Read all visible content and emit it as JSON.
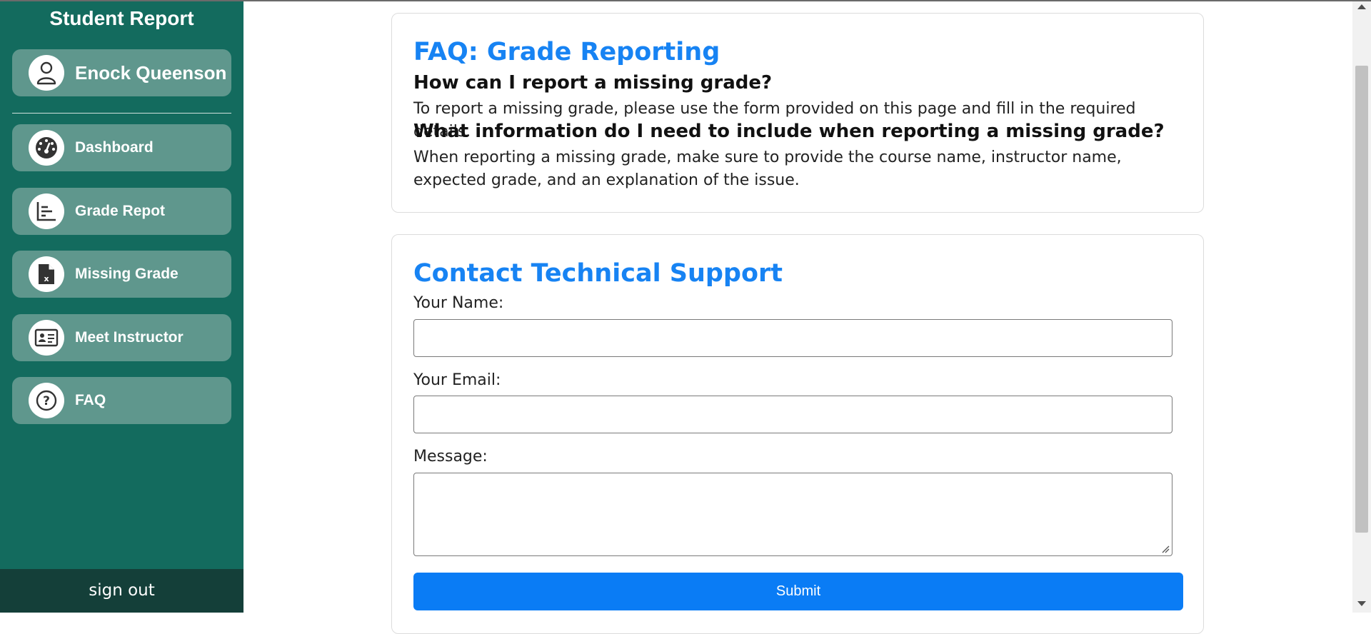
{
  "sidebar": {
    "title": "Student Report",
    "user_name": "Enock Queenson",
    "items": [
      {
        "label": "Dashboard",
        "icon": "dashboard-gauge-icon"
      },
      {
        "label": "Grade Repot",
        "icon": "bar-chart-icon"
      },
      {
        "label": "Missing Grade",
        "icon": "file-x-icon"
      },
      {
        "label": "Meet Instructor",
        "icon": "id-card-icon"
      },
      {
        "label": "FAQ",
        "icon": "question-circle-icon"
      }
    ],
    "sign_out": "sign out"
  },
  "faq": {
    "title": "FAQ: Grade Reporting",
    "q1": "How can I report a missing grade?",
    "a1": "To report a missing grade, please use the form provided on this page and fill in the required details.",
    "q2": "What information do I need to include when reporting a missing grade?",
    "a2": "When reporting a missing grade, make sure to provide the course name, instructor name, expected grade, and an explanation of the issue."
  },
  "support": {
    "title": "Contact Technical Support",
    "name_label": "Your Name:",
    "name_value": "",
    "email_label": "Your Email:",
    "email_value": "",
    "message_label": "Message:",
    "message_value": "",
    "submit_label": "Submit"
  },
  "colors": {
    "sidebar_bg": "#136b5e",
    "nav_item_bg": "#5f978d",
    "signout_bg": "#143f39",
    "accent": "#1783f3",
    "button": "#0a7cf5"
  }
}
